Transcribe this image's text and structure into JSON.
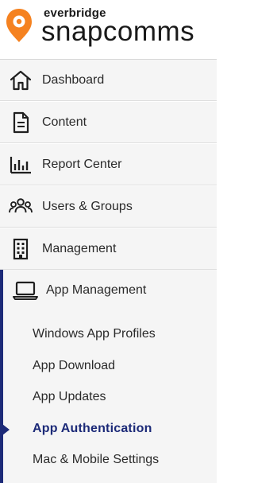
{
  "brand": {
    "small": "everbridge",
    "big": "snapcomms",
    "accent_color": "#f58220"
  },
  "nav": {
    "items": [
      {
        "label": "Dashboard",
        "icon": "home-icon"
      },
      {
        "label": "Content",
        "icon": "document-icon"
      },
      {
        "label": "Report Center",
        "icon": "bar-chart-icon"
      },
      {
        "label": "Users & Groups",
        "icon": "users-icon"
      },
      {
        "label": "Management",
        "icon": "building-icon"
      }
    ],
    "app_management": {
      "label": "App Management",
      "icon": "laptop-icon",
      "active_color": "#1c2a78",
      "children": [
        {
          "label": "Windows App Profiles"
        },
        {
          "label": "App Download"
        },
        {
          "label": "App Updates"
        },
        {
          "label": "App Authentication",
          "active": true
        },
        {
          "label": "Mac & Mobile Settings"
        }
      ]
    }
  }
}
